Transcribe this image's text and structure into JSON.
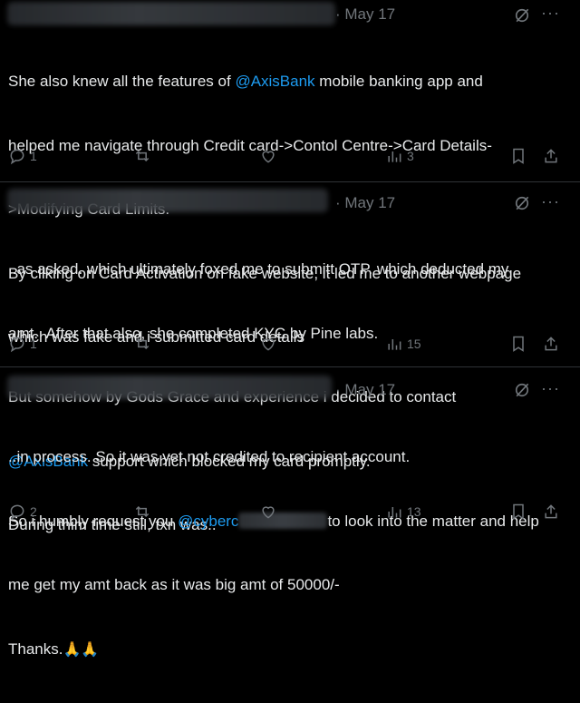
{
  "tweets": [
    {
      "date": "· May 17",
      "lines": [
        {
          "pre": "She also knew all the features of ",
          "mention": "@AxisBank",
          "post": " mobile banking app and"
        },
        {
          "text": "helped me navigate through Credit card->Contol Centre->Card Details-"
        },
        {
          "text": ">Modifying Card Limits."
        },
        {
          "text": "By cliking on Card Activation on fake website, it led me to another webpage"
        },
        {
          "text": "which was fake and i submitted card details"
        }
      ],
      "replies": "1",
      "views": "3"
    },
    {
      "date": "· May 17",
      "lines": [
        {
          "text": "..as asked. which ultimately foxed me to submitt OTP. which deducted my"
        },
        {
          "text": "amt.  After that also, she completed KYC by Pine labs."
        },
        {
          "text": "But somehow by Gods Grace and experience i decided to contact"
        },
        {
          "mention": "@AxisBank",
          "post": " support which blocked my card promptly."
        },
        {
          "text": "During thim time still, txn was.."
        }
      ],
      "replies": "1",
      "views": "15"
    },
    {
      "date": "· May 17",
      "lines": [
        {
          "text": "..in process. So it was yet not credited to recipient account."
        },
        {
          "pre": "So i humbly request you ",
          "mention": "@cyberc",
          "post": "to look into the matter and help"
        },
        {
          "text": "me get my amt back as it was big amt of 50000/-"
        },
        {
          "text": "Thanks."
        }
      ],
      "emoji": "🙏🙏",
      "replies": "2",
      "views": "13"
    }
  ],
  "more_label": "···",
  "colors": {
    "link": "#1d9bf0",
    "muted": "#71767b",
    "bg": "#000000"
  },
  "icons": [
    "reply-icon",
    "retweet-icon",
    "like-icon",
    "views-icon",
    "bookmark-icon",
    "share-icon",
    "grok-icon"
  ]
}
